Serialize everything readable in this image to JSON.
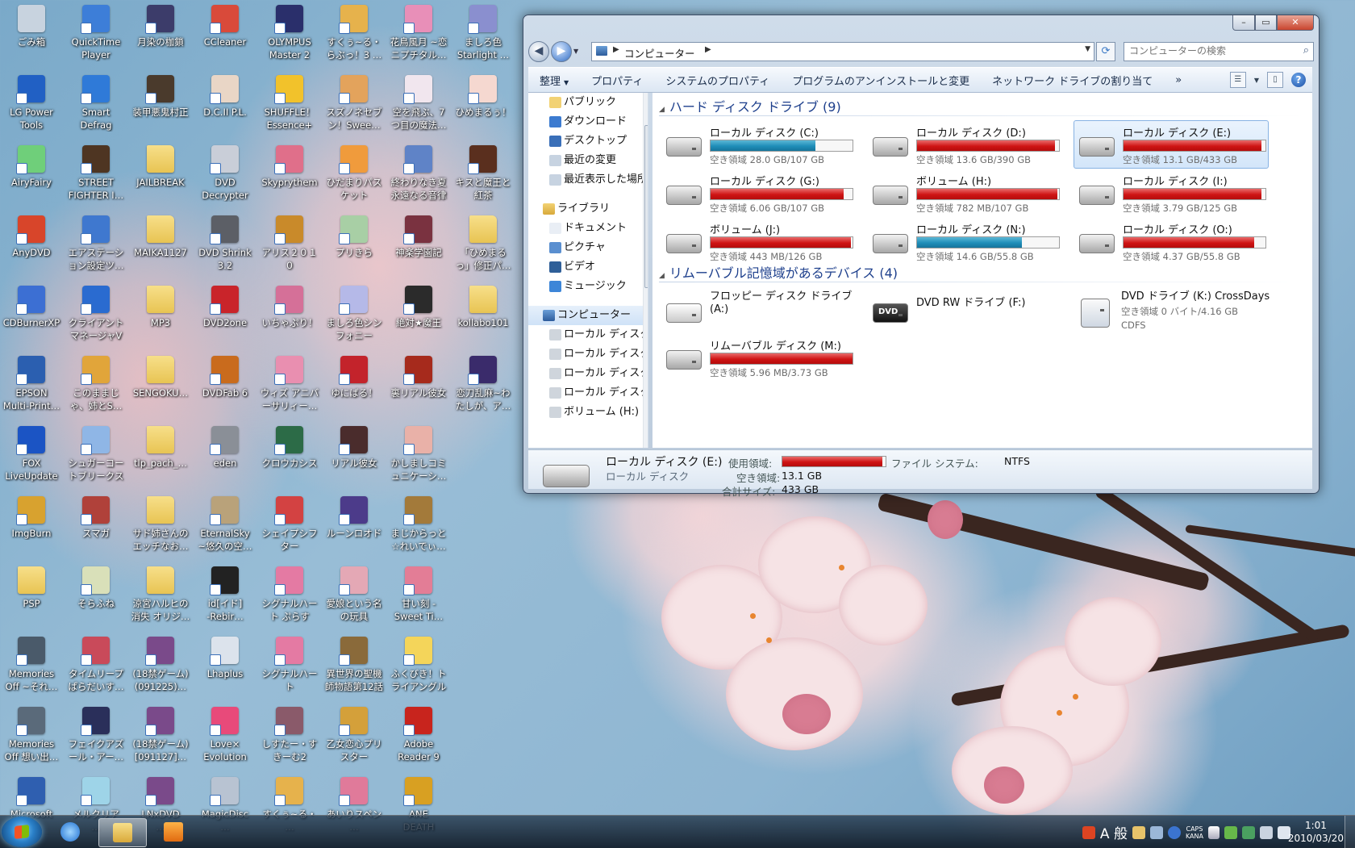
{
  "desktop": {
    "icons": [
      {
        "label": "ごみ箱",
        "color": "#c8d3df"
      },
      {
        "label": "QuickTime\nPlayer",
        "color": "#3d7ed8"
      },
      {
        "label": "月染の枷鎖",
        "color": "#3c3c6a"
      },
      {
        "label": "CCleaner",
        "color": "#d94a3a"
      },
      {
        "label": "OLYMPUS\nMaster 2",
        "color": "#2a2f6b"
      },
      {
        "label": "すくぅ~る・\nらぶっ！3 …",
        "color": "#e6b24c"
      },
      {
        "label": "花鳥風月 ~恋\nニプチタル…",
        "color": "#e88fb8"
      },
      {
        "label": "ましろ色\nStarlight …",
        "color": "#8a8fcf"
      },
      {
        "label": "LG Power\nTools",
        "color": "#2160c4"
      },
      {
        "label": "Smart\nDefrag",
        "color": "#2f7ad8"
      },
      {
        "label": "装甲悪鬼村正",
        "color": "#4a3a2c"
      },
      {
        "label": "D.C.II P.L.",
        "color": "#e9d6c6"
      },
      {
        "label": "SHUFFLE！\nEssence+",
        "color": "#f2c22b"
      },
      {
        "label": "スズノネセブ\nン！Swee…",
        "color": "#e3a35c"
      },
      {
        "label": "空を飛ぶ、7\nつ目の魔法…",
        "color": "#f1e6ee"
      },
      {
        "label": "ひめまるぅ！",
        "color": "#f5d8d0"
      },
      {
        "label": "AiryFairy",
        "color": "#6fcf7a"
      },
      {
        "label": "STREET\nFIGHTER I…",
        "color": "#4e3522"
      },
      {
        "label": "JAILBREAK",
        "color": "#f2d274",
        "folder": true
      },
      {
        "label": "DVD\nDecrypter",
        "color": "#c9ced8"
      },
      {
        "label": "Skyprythem",
        "color": "#e06f8a"
      },
      {
        "label": "ひだまりパス\nケット",
        "color": "#f09b3c"
      },
      {
        "label": "終わりなき夏\n永遠なる音律",
        "color": "#5f83c7"
      },
      {
        "label": "キスと魔王と\n紅茶",
        "color": "#5a2f1e"
      },
      {
        "label": "AnyDVD",
        "color": "#d8452a"
      },
      {
        "label": "エアステーシ\nョン設定ツ…",
        "color": "#3f78cf"
      },
      {
        "label": "MAIKA1127",
        "color": "#f2d274",
        "folder": true
      },
      {
        "label": "DVD Shrink\n3.2",
        "color": "#5c5f66"
      },
      {
        "label": "アリス２０１\n０",
        "color": "#c98a2a"
      },
      {
        "label": "プリきら",
        "color": "#a8cfa5"
      },
      {
        "label": "神楽学園記",
        "color": "#7a3240"
      },
      {
        "label": "「ひめまる\nっ」修正パ…",
        "color": "#f2d274",
        "folder": true
      },
      {
        "label": "CDBurnerXP",
        "color": "#3c6fd3"
      },
      {
        "label": "クライアント\nマネージャV",
        "color": "#2a6bd0"
      },
      {
        "label": "MP3",
        "color": "#f2d274",
        "folder": true
      },
      {
        "label": "DVD2one",
        "color": "#c9242a"
      },
      {
        "label": "いちゃぷり！",
        "color": "#d57098"
      },
      {
        "label": "ましろ色シン\nフォニー",
        "color": "#b5b9e8"
      },
      {
        "label": "絶対★魔王",
        "color": "#2b2b2b"
      },
      {
        "label": "kollabo101",
        "color": "#f2d274",
        "folder": true
      },
      {
        "label": "EPSON\nMulti-Print…",
        "color": "#2b5fb0"
      },
      {
        "label": "このままじ\nゃ、姉とS…",
        "color": "#e1a53a"
      },
      {
        "label": "SENGOKU…",
        "color": "#f2d274",
        "folder": true
      },
      {
        "label": "DVDFab 6",
        "color": "#c96b1d"
      },
      {
        "label": "ウィズ アニバ\nーサリィー…",
        "color": "#e98fb0"
      },
      {
        "label": "ゆにばる！",
        "color": "#c3232b"
      },
      {
        "label": "裏リアル彼女",
        "color": "#a62a1c"
      },
      {
        "label": "恋刀乱麻~わ\nたしが、ア…",
        "color": "#3a2b6b"
      },
      {
        "label": "FOX\nLiveUpdate",
        "color": "#1b54c4"
      },
      {
        "label": "シュガーコー\nトブリークス",
        "color": "#8fb6e6"
      },
      {
        "label": "tlp_pach_…",
        "color": "#f2d274",
        "folder": true
      },
      {
        "label": "eden",
        "color": "#8a8f97"
      },
      {
        "label": "クロウカシス",
        "color": "#2c6b47"
      },
      {
        "label": "リアル彼女",
        "color": "#4a2c2c"
      },
      {
        "label": "かしましコミ\nュニケーシ…",
        "color": "#e9b1a8"
      },
      {
        "label": "",
        "color": "transparent",
        "blank": true
      },
      {
        "label": "ImgBurn",
        "color": "#d8a22f"
      },
      {
        "label": "スマガ",
        "color": "#b0413a"
      },
      {
        "label": "サド姉さんの\nエッチなお…",
        "color": "#f2d274",
        "folder": true
      },
      {
        "label": "EternalSky\n~悠久の空…",
        "color": "#b9a27a"
      },
      {
        "label": "シェイプシフ\nター",
        "color": "#d34242"
      },
      {
        "label": "ルーンロオド",
        "color": "#4c3b8a"
      },
      {
        "label": "まじからっと\n☆れいでぃ…",
        "color": "#a37a3a"
      },
      {
        "label": "",
        "color": "transparent",
        "blank": true
      },
      {
        "label": "PSP",
        "color": "#f2d274",
        "folder": true
      },
      {
        "label": "そらふね",
        "color": "#d9e0b9"
      },
      {
        "label": "涼宮ハルヒの\n消失 オリジ…",
        "color": "#f2d274",
        "folder": true
      },
      {
        "label": "id[イド]\n-Rebir…",
        "color": "#222"
      },
      {
        "label": "シグナルハー\nト ぷらす",
        "color": "#e47aa3"
      },
      {
        "label": "愛娘という名\nの玩具",
        "color": "#e4a8b5"
      },
      {
        "label": "甘い刻 -\nSweet Ti…",
        "color": "#e37d96"
      },
      {
        "label": "",
        "color": "transparent",
        "blank": true
      },
      {
        "label": "Memories\nOff ~それ…",
        "color": "#4a5a6a"
      },
      {
        "label": "タイムリープ\nぱらだいす…",
        "color": "#c94a5a"
      },
      {
        "label": "(18禁ゲーム)\n(091225)…",
        "color": "#7a4a8a"
      },
      {
        "label": "Lhaplus",
        "color": "#dce3ec"
      },
      {
        "label": "シグナルハー\nト",
        "color": "#e47aa3"
      },
      {
        "label": "異世界の聖機\n師物語第12話",
        "color": "#8a6a3a"
      },
      {
        "label": "ふくびき！ト\nライアングル",
        "color": "#f4d55a"
      },
      {
        "label": "",
        "color": "transparent",
        "blank": true
      },
      {
        "label": "Memories\nOff 想い出…",
        "color": "#5a6a7a"
      },
      {
        "label": "フェイクアズ\nール・アー…",
        "color": "#2a2f5a"
      },
      {
        "label": "(18禁ゲーム)\n[091127]…",
        "color": "#7a4a8a"
      },
      {
        "label": "Love×\nEvolution",
        "color": "#e84a7a"
      },
      {
        "label": "しすたー・す\nきーむ2",
        "color": "#8a5a6a"
      },
      {
        "label": "乙女恋心プリ\nスター",
        "color": "#d4a03a"
      },
      {
        "label": "Adobe\nReader 9",
        "color": "#c8241d"
      },
      {
        "label": "",
        "color": "transparent",
        "blank": true
      },
      {
        "label": "Microsoft\n…",
        "color": "#2f5fb0"
      },
      {
        "label": "メルクリア\n…",
        "color": "#9ed4e8"
      },
      {
        "label": "LNxDVD\n…",
        "color": "#7a4a8a"
      },
      {
        "label": "MagicDisc\n…",
        "color": "#b8c3d2"
      },
      {
        "label": "すくぅ~る・\n…",
        "color": "#e6b24c"
      },
      {
        "label": "あいりスペン\n…",
        "color": "#e07a9a"
      },
      {
        "label": "ANE\nDEATH",
        "color": "#d8a022"
      },
      {
        "label": "",
        "color": "transparent",
        "blank": true
      }
    ]
  },
  "window": {
    "controls": {
      "minimize": "–",
      "maximize": "▭",
      "close": "✕"
    },
    "address": {
      "crumb": "コンピューター"
    },
    "search": {
      "placeholder": "コンピューターの検索"
    },
    "toolbar": {
      "organize": "整理",
      "properties": "プロパティ",
      "system_properties": "システムのプロパティ",
      "uninstall": "プログラムのアンインストールと変更",
      "map_drive": "ネットワーク ドライブの割り当て",
      "more": "»"
    },
    "nav": {
      "favorites": [
        "パブリック",
        "ダウンロード",
        "デスクトップ",
        "最近の変更",
        "最近表示した場所"
      ],
      "libraries_label": "ライブラリ",
      "libraries": [
        "ドキュメント",
        "ピクチャ",
        "ビデオ",
        "ミュージック"
      ],
      "computer_label": "コンピューター",
      "computer_items": [
        "ローカル ディスク",
        "ローカル ディスク",
        "ローカル ディスク",
        "ローカル ディスク",
        "ボリューム (H:)"
      ]
    },
    "groups": {
      "hdd": "ハード ディスク ドライブ (9)",
      "removable": "リムーバブル記憶域があるデバイス (4)"
    },
    "drives": [
      {
        "name": "ローカル ディスク (C:)",
        "free": "空き領域 28.0 GB/107 GB",
        "used": 0.74,
        "color": "blue"
      },
      {
        "name": "ローカル ディスク (D:)",
        "free": "空き領域 13.6 GB/390 GB",
        "used": 0.97,
        "color": "red"
      },
      {
        "name": "ローカル ディスク (E:)",
        "free": "空き領域 13.1 GB/433 GB",
        "used": 0.97,
        "color": "red",
        "selected": true
      },
      {
        "name": "ローカル ディスク (G:)",
        "free": "空き領域 6.06 GB/107 GB",
        "used": 0.94,
        "color": "red"
      },
      {
        "name": "ボリューム (H:)",
        "free": "空き領域 782 MB/107 GB",
        "used": 0.99,
        "color": "red"
      },
      {
        "name": "ローカル ディスク (I:)",
        "free": "空き領域 3.79 GB/125 GB",
        "used": 0.97,
        "color": "red"
      },
      {
        "name": "ボリューム (J:)",
        "free": "空き領域 443 MB/126 GB",
        "used": 0.99,
        "color": "red"
      },
      {
        "name": "ローカル ディスク (N:)",
        "free": "空き領域 14.6 GB/55.8 GB",
        "used": 0.74,
        "color": "blue"
      },
      {
        "name": "ローカル ディスク (O:)",
        "free": "空き領域 4.37 GB/55.8 GB",
        "used": 0.92,
        "color": "red"
      }
    ],
    "devices": [
      {
        "name": "フロッピー ディスク ドライブ (A:)"
      },
      {
        "name": "DVD RW ドライブ (F:)",
        "badge": "DVD"
      },
      {
        "name": "DVD ドライブ (K:) CrossDays",
        "free": "空き領域 0 バイト/4.16 GB",
        "fs": "CDFS"
      },
      {
        "name": "リムーバブル ディスク (M:)",
        "free": "空き領域 5.96 MB/3.73 GB",
        "used": 0.998
      }
    ],
    "details": {
      "title": "ローカル ディスク (E:)",
      "subtitle": "ローカル ディスク",
      "used_label": "使用領域:",
      "free_label": "空き領域:",
      "free_value": "13.1 GB",
      "total_label": "合計サイズ:",
      "total_value": "433 GB",
      "fs_label": "ファイル システム:",
      "fs_value": "NTFS",
      "used": 0.97
    }
  },
  "taskbar": {
    "ime": "A 般",
    "caps": "CAPS\nKANA",
    "time": "1:01",
    "date": "2010/03/20"
  }
}
